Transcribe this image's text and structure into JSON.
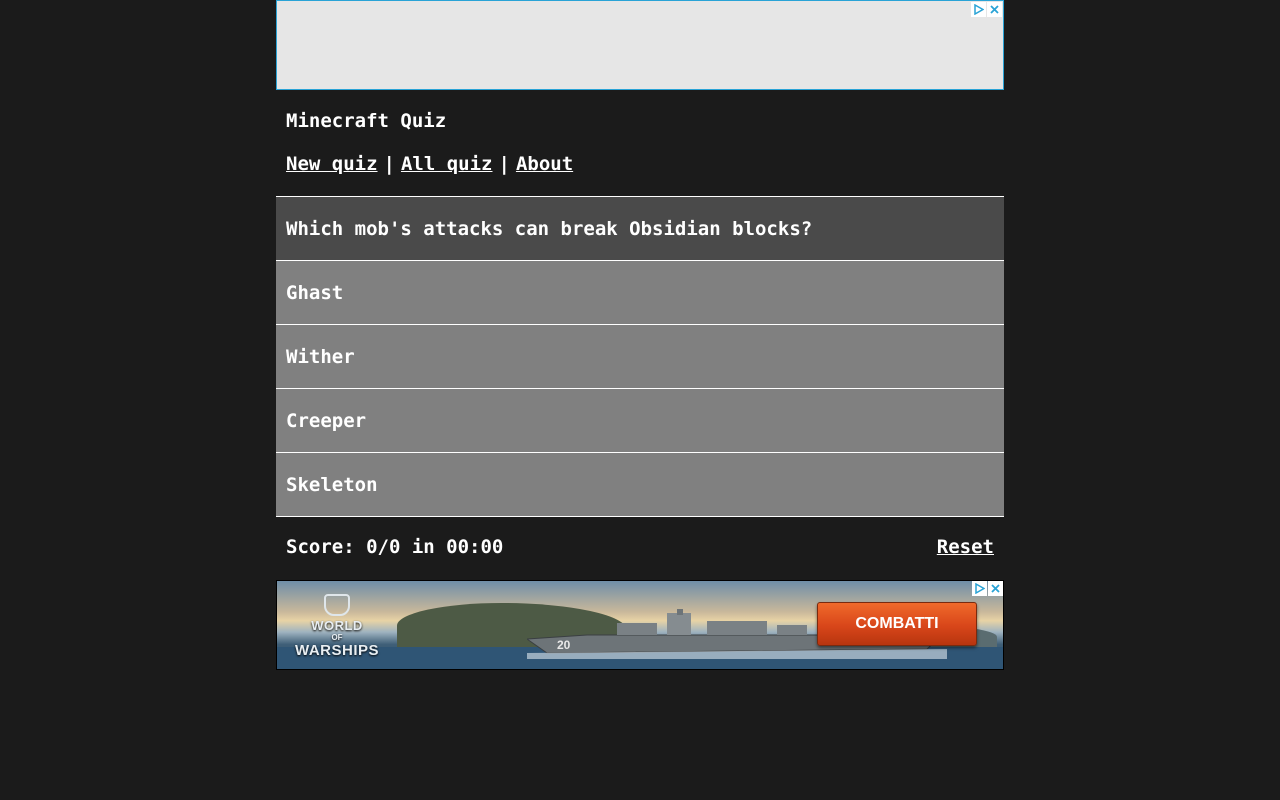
{
  "page": {
    "title": "Minecraft Quiz"
  },
  "nav": {
    "new_quiz": "New quiz",
    "all_quiz": "All quiz",
    "about": "About",
    "separator": "|"
  },
  "quiz": {
    "question": "Which mob's attacks can break Obsidian blocks?",
    "answers": [
      "Ghast",
      "Wither",
      "Creeper",
      "Skeleton"
    ]
  },
  "score": {
    "text": "Score: 0/0 in 00:00",
    "reset_label": "Reset"
  },
  "ads": {
    "top": {
      "adchoices_icon": "adchoices-icon",
      "close_icon": "close-icon"
    },
    "bottom": {
      "brand_line1": "WORLD",
      "brand_line2": "OF",
      "brand_line3": "WARSHIPS",
      "cta_label": "COMBATTI",
      "ship_number": "20",
      "adchoices_icon": "adchoices-icon",
      "close_icon": "close-icon"
    }
  },
  "colors": {
    "background": "#1b1b1b",
    "question_bg": "#4a4a4a",
    "answer_bg": "#808080",
    "ad_border": "#29a3d6",
    "cta": "#d8461a"
  }
}
